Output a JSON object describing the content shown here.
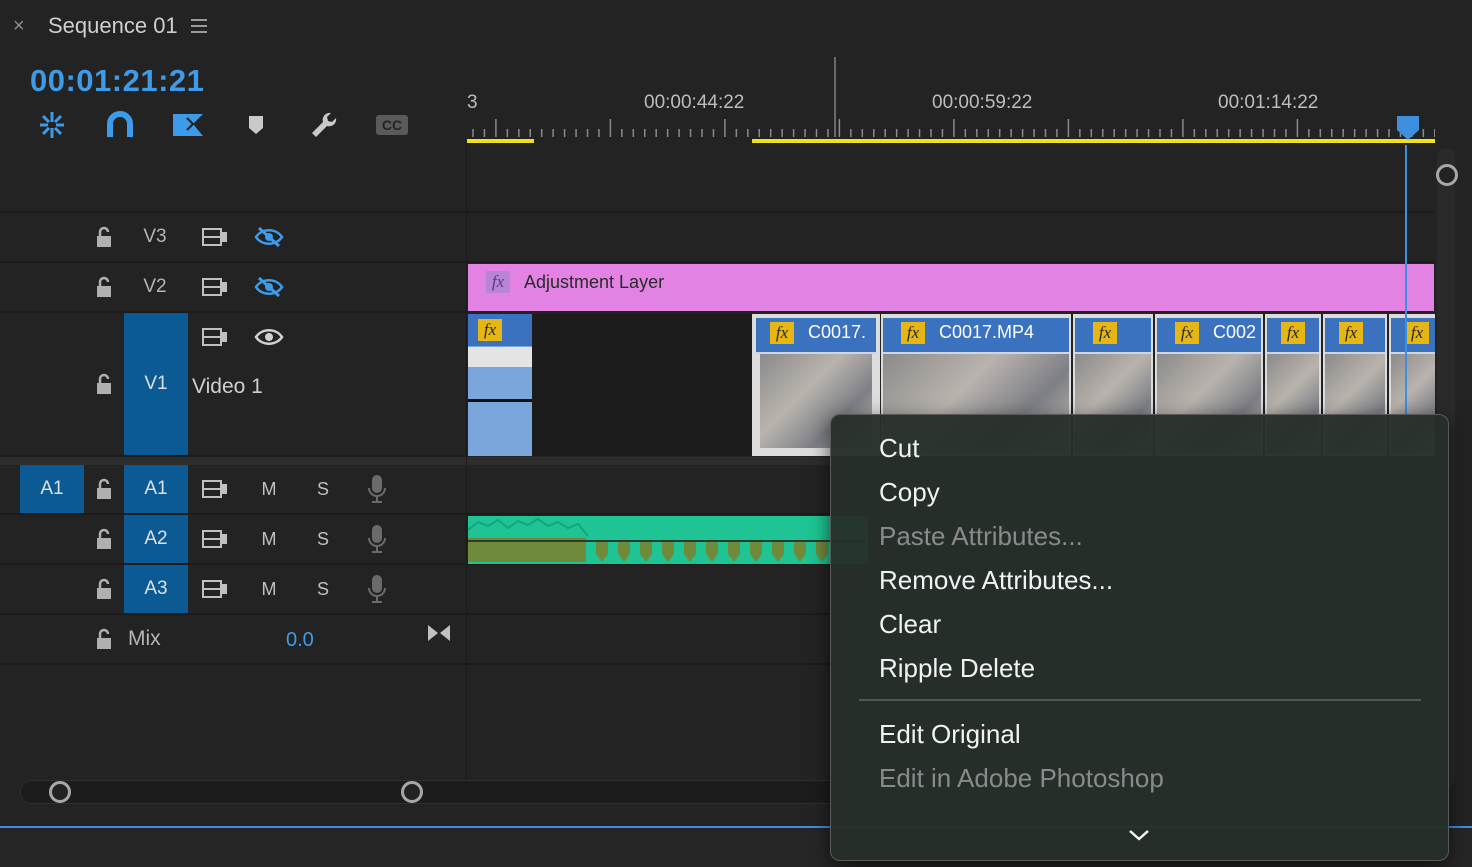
{
  "tab": {
    "close": "×",
    "title": "Sequence 01",
    "menu_icon": "hamburger-icon"
  },
  "timecode": "00:01:21:21",
  "toolbar": {
    "icons": [
      "insert-nest-icon",
      "snap-magnet-icon",
      "linked-selection-icon",
      "marker-icon",
      "wrench-icon",
      "cc-icon"
    ],
    "cc_label": "CC"
  },
  "ruler": {
    "labels": [
      "3",
      "00:00:44:22",
      "00:00:59:22",
      "00:01:14:22"
    ]
  },
  "tracks": {
    "v3": {
      "label": "V3"
    },
    "v2": {
      "label": "V2"
    },
    "v1": {
      "label": "V1",
      "name": "Video 1"
    },
    "a1": {
      "source": "A1",
      "label": "A1",
      "m": "M",
      "s": "S"
    },
    "a2": {
      "label": "A2",
      "m": "M",
      "s": "S"
    },
    "a3": {
      "label": "A3",
      "m": "M",
      "s": "S"
    },
    "mix": {
      "label": "Mix",
      "value": "0.0"
    }
  },
  "clips": {
    "adjustment": {
      "fx": "fx",
      "label": "Adjustment Layer"
    },
    "c1": {
      "fx": "fx"
    },
    "c2": {
      "fx": "fx",
      "label": "C0017."
    },
    "c3": {
      "fx": "fx",
      "label": "C0017.MP4"
    },
    "c4": {
      "fx": "fx"
    },
    "c5": {
      "fx": "fx",
      "label": "C002"
    },
    "c6": {
      "fx": "fx"
    },
    "c7": {
      "fx": "fx"
    },
    "c8": {
      "fx": "fx"
    }
  },
  "colors": {
    "accent": "#3d9be9",
    "adjustment": "#e283e3",
    "clip": "#3a72c0",
    "audio": "#1ec493",
    "fx": "#e6b614",
    "work_area": "#f0e11c"
  },
  "context_menu": {
    "items": [
      {
        "label": "Cut",
        "enabled": true
      },
      {
        "label": "Copy",
        "enabled": true
      },
      {
        "label": "Paste Attributes...",
        "enabled": false
      },
      {
        "label": "Remove Attributes...",
        "enabled": true
      },
      {
        "label": "Clear",
        "enabled": true
      },
      {
        "label": "Ripple Delete",
        "enabled": true
      },
      {
        "label": "Edit Original",
        "enabled": true
      },
      {
        "label": "Edit in Adobe Photoshop",
        "enabled": false
      }
    ],
    "more_icon": "chevron-down-icon"
  }
}
